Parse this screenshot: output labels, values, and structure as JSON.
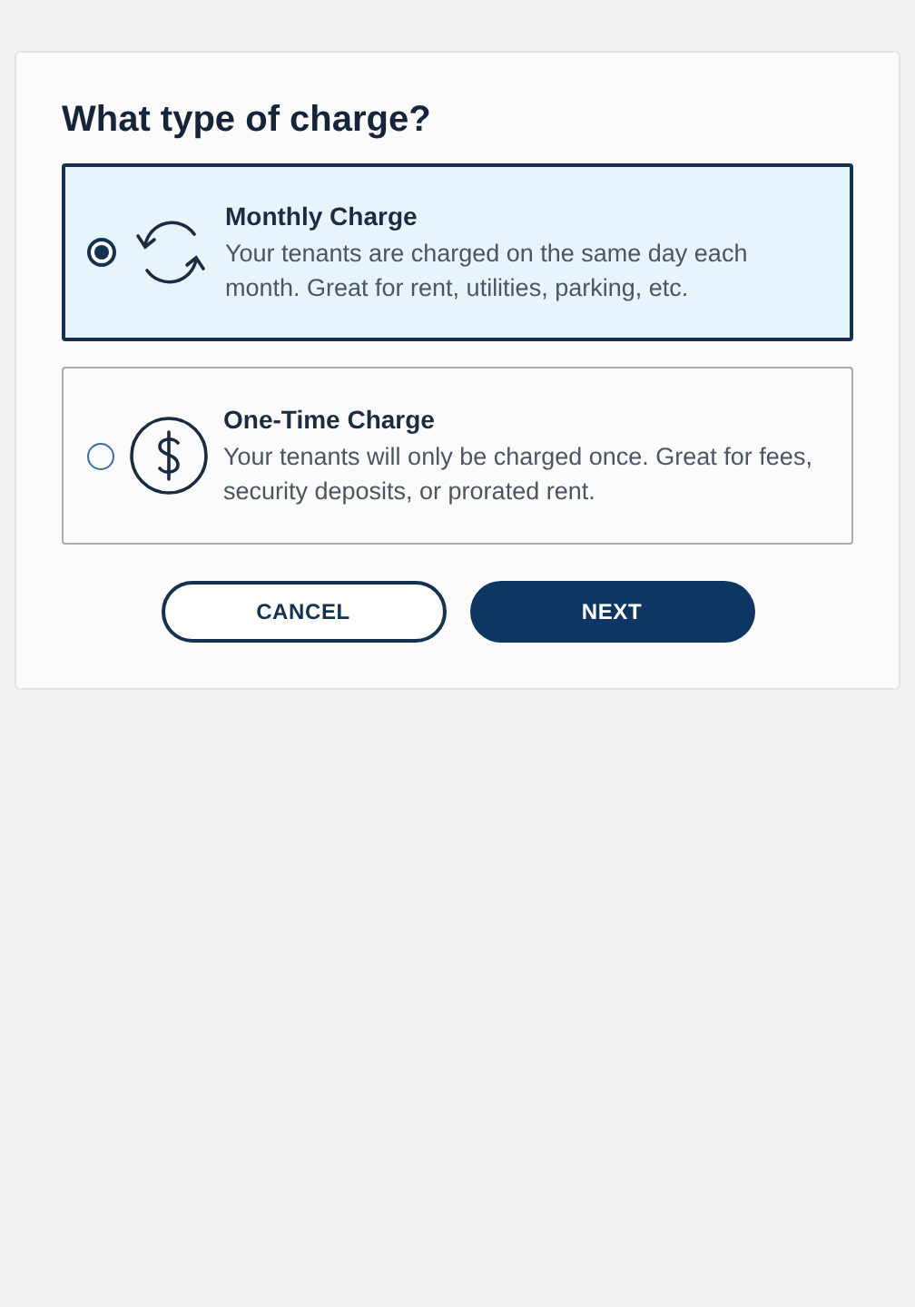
{
  "title": "What type of charge?",
  "options": [
    {
      "kind": "recurring",
      "title": "Monthly Charge",
      "description": "Your tenants are charged on the same day each month. Great for rent, utilities, parking, etc.",
      "selected": true
    },
    {
      "kind": "one-time",
      "title": "One-Time Charge",
      "description": "Your tenants will only be charged once. Great for fees, security deposits, or prorated rent.",
      "selected": false
    }
  ],
  "buttons": [
    {
      "kind": "secondary",
      "label": "CANCEL"
    },
    {
      "kind": "primary",
      "label": "NEXT"
    }
  ]
}
